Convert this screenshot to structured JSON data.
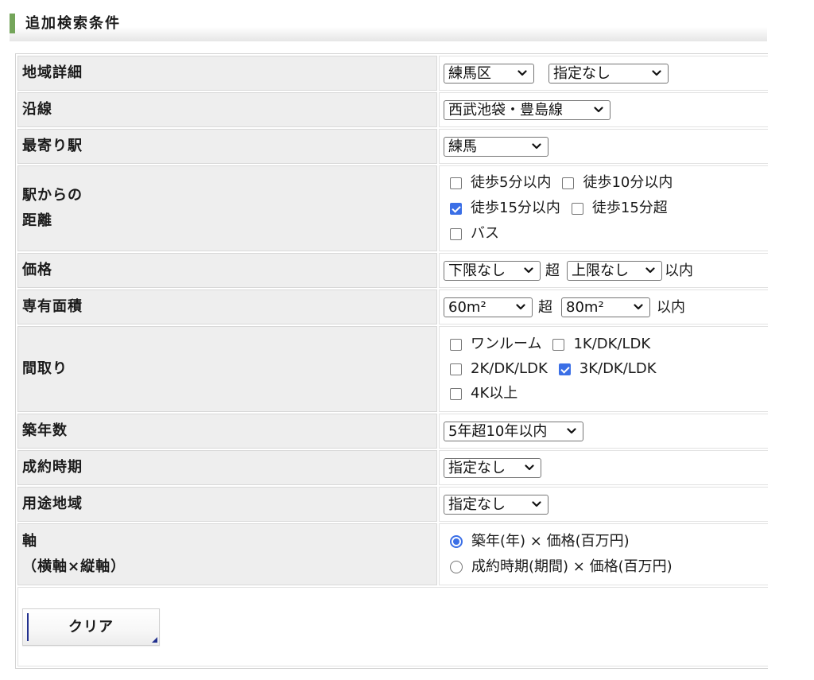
{
  "section_title": "追加検索条件",
  "colors": {
    "accent": "#3b6fe6",
    "section_marker": "#74a55a",
    "label_bg": "#eeeeee",
    "button_accent": "#22318f"
  },
  "conditions": {
    "area_detail": {
      "label": "地域詳細",
      "ward": "練馬区",
      "detail": "指定なし"
    },
    "railway_line": {
      "label": "沿線",
      "selected": "西武池袋・豊島線"
    },
    "nearest_station": {
      "label": "最寄り駅",
      "selected": "練馬"
    },
    "distance": {
      "label_lines": [
        "駅からの",
        "距離"
      ],
      "options": [
        {
          "label": "徒歩5分以内",
          "checked": false
        },
        {
          "label": "徒歩10分以内",
          "checked": false
        },
        {
          "label": "徒歩15分以内",
          "checked": true
        },
        {
          "label": "徒歩15分超",
          "checked": false
        },
        {
          "label": "バス",
          "checked": false
        }
      ]
    },
    "price": {
      "label": "価格",
      "min": "下限なし",
      "over": "超",
      "max": "上限なし",
      "within": "以内"
    },
    "floor_area": {
      "label": "専有面積",
      "min": "60m²",
      "over": "超",
      "max": "80m²",
      "within": "以内"
    },
    "floor_plan": {
      "label": "間取り",
      "options": [
        {
          "label": "ワンルーム",
          "checked": false
        },
        {
          "label": "1K/DK/LDK",
          "checked": false
        },
        {
          "label": "2K/DK/LDK",
          "checked": false
        },
        {
          "label": "3K/DK/LDK",
          "checked": true
        },
        {
          "label": "4K以上",
          "checked": false
        }
      ]
    },
    "building_age": {
      "label": "築年数",
      "selected": "5年超10年以内"
    },
    "contract_period": {
      "label": "成約時期",
      "selected": "指定なし"
    },
    "zoning": {
      "label": "用途地域",
      "selected": "指定なし"
    },
    "axis": {
      "label_lines": [
        "軸",
        "（横軸×縦軸）"
      ],
      "options": [
        {
          "label": "築年(年) × 価格(百万円)",
          "selected": true
        },
        {
          "label": "成約時期(期間) × 価格(百万円)",
          "selected": false
        }
      ]
    }
  },
  "clear_button": "クリア"
}
